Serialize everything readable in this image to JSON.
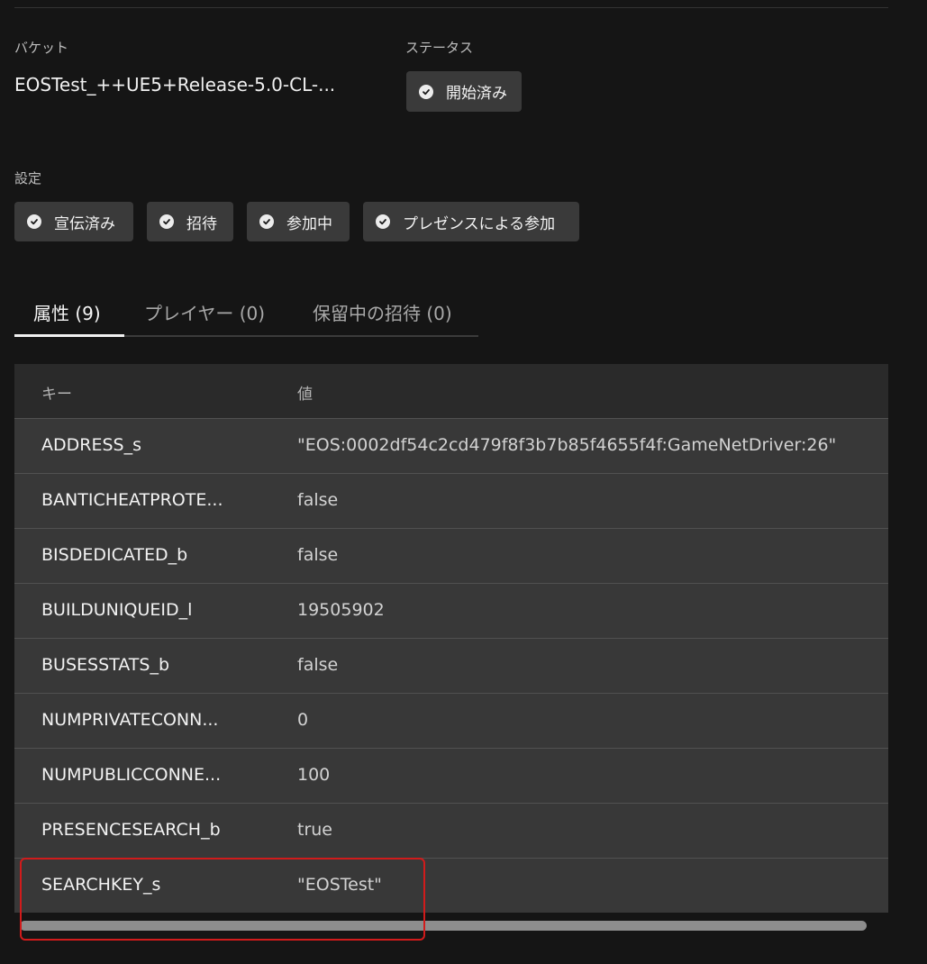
{
  "bucket": {
    "label": "バケット",
    "value": "EOSTest_++UE5+Release-5.0-CL-..."
  },
  "status": {
    "label": "ステータス",
    "badge": "開始済み"
  },
  "settings": {
    "label": "設定",
    "chips": [
      "宣伝済み",
      "招待",
      "参加中",
      "プレゼンスによる参加"
    ]
  },
  "tabs": [
    {
      "label": "属性 (9)",
      "active": true
    },
    {
      "label": "プレイヤー (0)",
      "active": false
    },
    {
      "label": "保留中の招待 (0)",
      "active": false
    }
  ],
  "attributes": {
    "headers": {
      "key": "キー",
      "value": "値"
    },
    "rows": [
      {
        "key": "ADDRESS_s",
        "value": "\"EOS:0002df54c2cd479f8f3b7b85f4655f4f:GameNetDriver:26\""
      },
      {
        "key": "BANTICHEATPROTE...",
        "value": "false"
      },
      {
        "key": "BISDEDICATED_b",
        "value": "false"
      },
      {
        "key": "BUILDUNIQUEID_l",
        "value": "19505902"
      },
      {
        "key": "BUSESSTATS_b",
        "value": "false"
      },
      {
        "key": "NUMPRIVATECONN...",
        "value": "0"
      },
      {
        "key": "NUMPUBLICCONNE...",
        "value": "100"
      },
      {
        "key": "PRESENCESEARCH_b",
        "value": "true"
      },
      {
        "key": "SEARCHKEY_s",
        "value": "\"EOSTest\""
      }
    ]
  },
  "icons": {
    "chip_icon": "check-circle-icon"
  },
  "colors": {
    "highlight": "#d11b1b",
    "background": "#151515",
    "chip": "#3a3a3a"
  }
}
